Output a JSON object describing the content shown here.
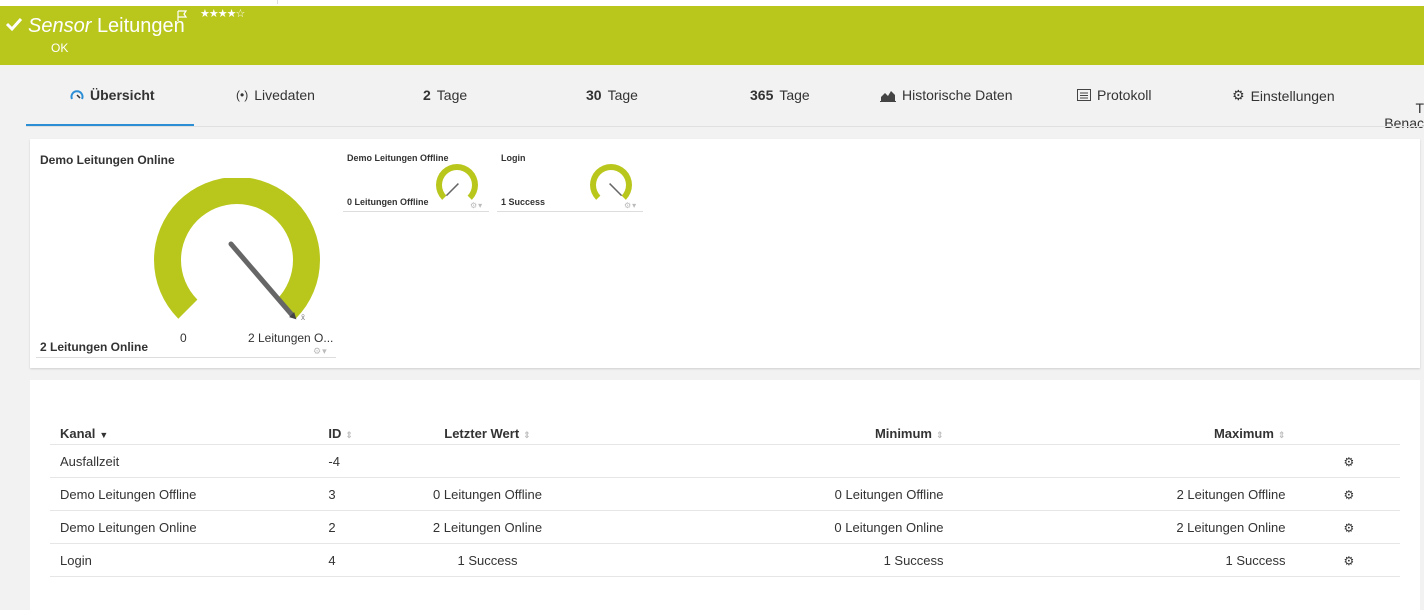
{
  "header": {
    "title_italic": "Sensor",
    "title_rest": "Leitungen",
    "stars": "★★★★☆",
    "status": "OK",
    "accent": "#b9c71d"
  },
  "tabs": [
    {
      "label": "Übersicht",
      "icon": "gauge-icon",
      "active": true
    },
    {
      "label": "Livedaten",
      "icon": "live-signal-icon"
    },
    {
      "num": "2",
      "label": "Tage"
    },
    {
      "num": "30",
      "label": "Tage"
    },
    {
      "num": "365",
      "label": "Tage"
    },
    {
      "label": "Historische Daten",
      "icon": "area-chart-icon"
    },
    {
      "label": "Protokoll",
      "icon": "log-icon"
    },
    {
      "label": "Einstellungen",
      "icon": "gear-icon"
    }
  ],
  "tab_cut": {
    "line1": "T",
    "line2": "Benac"
  },
  "gauges": {
    "main": {
      "title": "Demo Leitungen Online",
      "value": "2 Leitungen Online",
      "min_label": "0",
      "max_label": "2 Leitungen O...",
      "needle_fraction": 1.0
    },
    "offline": {
      "title": "Demo Leitungen Offline",
      "value": "0 Leitungen Offline",
      "needle_fraction": 0.0
    },
    "login": {
      "title": "Login",
      "value": "1 Success",
      "needle_fraction": 1.0
    }
  },
  "table": {
    "headers": {
      "kanal": "Kanal",
      "id": "ID",
      "letzter": "Letzter Wert",
      "minimum": "Minimum",
      "maximum": "Maximum"
    },
    "rows": [
      {
        "kanal": "Ausfallzeit",
        "id": "-4",
        "letzter": "",
        "minimum": "",
        "maximum": ""
      },
      {
        "kanal": "Demo Leitungen Offline",
        "id": "3",
        "letzter": "0 Leitungen Offline",
        "minimum": "0 Leitungen Offline",
        "maximum": "2 Leitungen Offline"
      },
      {
        "kanal": "Demo Leitungen Online",
        "id": "2",
        "letzter": "2 Leitungen Online",
        "minimum": "0 Leitungen Online",
        "maximum": "2 Leitungen Online"
      },
      {
        "kanal": "Login",
        "id": "4",
        "letzter": "1 Success",
        "minimum": "1 Success",
        "maximum": "1 Success"
      }
    ]
  }
}
